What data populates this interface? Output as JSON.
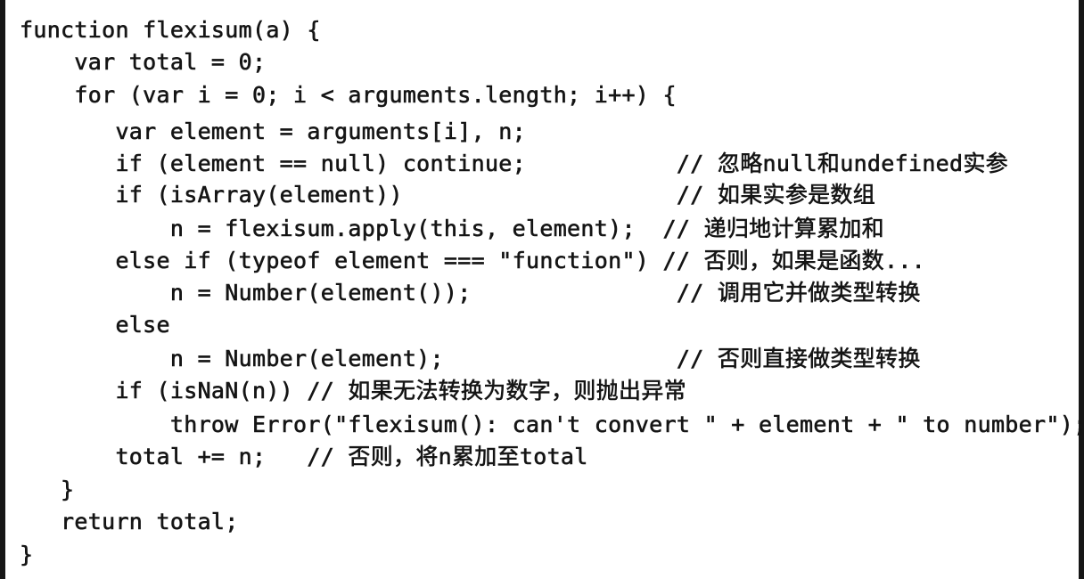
{
  "code": {
    "lines": [
      "function flexisum(a) {",
      "    var total = 0;",
      "    for (var i = 0; i < arguments.length; i++) {",
      "       var element = arguments[i], n;",
      "       if (element == null) continue;           // 忽略null和undefined实参",
      "       if (isArray(element))                    // 如果实参是数组",
      "           n = flexisum.apply(this, element);  // 递归地计算累加和",
      "       else if (typeof element === \"function\") // 否则，如果是函数...",
      "           n = Number(element());               // 调用它并做类型转换",
      "       else",
      "           n = Number(element);                 // 否则直接做类型转换",
      "       if (isNaN(n)) // 如果无法转换为数字，则抛出异常",
      "           throw Error(\"flexisum(): can't convert \" + element + \" to number\");",
      "       total += n;   // 否则，将n累加至total",
      "   }",
      "   return total;",
      "}"
    ]
  }
}
